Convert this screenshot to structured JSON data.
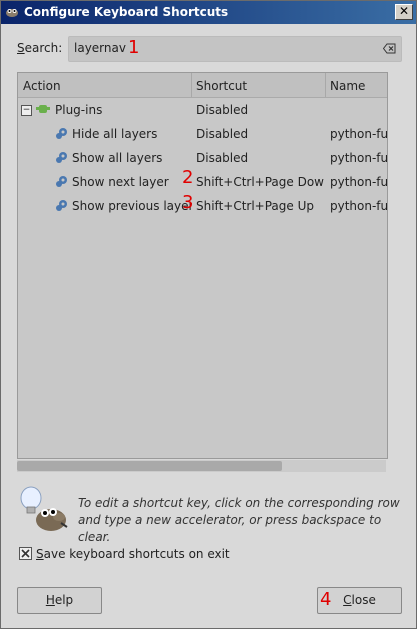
{
  "window": {
    "title": "Configure Keyboard Shortcuts",
    "close_glyph": "✕"
  },
  "search": {
    "label_mnemonic": "S",
    "label_rest": "earch:",
    "value": "layernav"
  },
  "tree": {
    "headers": {
      "action": "Action",
      "shortcut": "Shortcut",
      "name": "Name"
    },
    "group": {
      "label": "Plug-ins",
      "shortcut": "Disabled",
      "expander": "−"
    },
    "rows": [
      {
        "action": "Hide all layers",
        "shortcut": "Disabled",
        "name": "python-fu-"
      },
      {
        "action": "Show all layers",
        "shortcut": "Disabled",
        "name": "python-fu-"
      },
      {
        "action": "Show next layer",
        "shortcut": "Shift+Ctrl+Page Down",
        "name": "python-fu-"
      },
      {
        "action": "Show previous layer",
        "shortcut": "Shift+Ctrl+Page Up",
        "name": "python-fu-"
      }
    ]
  },
  "info": {
    "text": "To edit a shortcut key, click on the corresponding row and type a new accelerator, or press backspace to clear."
  },
  "save_option": {
    "mnemonic": "S",
    "rest": "ave keyboard shortcuts on exit",
    "checked": true
  },
  "buttons": {
    "help": {
      "mnemonic": "H",
      "rest": "elp"
    },
    "close": {
      "mnemonic": "C",
      "rest": "lose"
    }
  },
  "markers": [
    "1",
    "2",
    "3",
    "4"
  ],
  "colors": {
    "titlebar": "#0a246a",
    "marker": "#e00000",
    "plugin_icon": "#6ab04c"
  }
}
